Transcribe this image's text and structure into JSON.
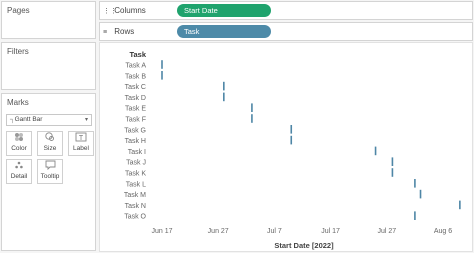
{
  "left_panel": {
    "pages_label": "Pages",
    "filters_label": "Filters",
    "marks_label": "Marks",
    "mark_type": "Gantt Bar",
    "mark_buttons": [
      {
        "label": "Color",
        "icon": "color-icon"
      },
      {
        "label": "Size",
        "icon": "size-icon"
      },
      {
        "label": "Label",
        "icon": "label-icon"
      },
      {
        "label": "Detail",
        "icon": "detail-icon"
      },
      {
        "label": "Tooltip",
        "icon": "tooltip-icon"
      }
    ]
  },
  "shelves": {
    "columns_label": "Columns",
    "columns_pill": "Start Date",
    "rows_label": "Rows",
    "rows_pill": "Task"
  },
  "colors": {
    "columns_pill": "#1fa36d",
    "rows_pill": "#4d8aa8",
    "gantt_mark": "#4e86a6"
  },
  "chart_data": {
    "type": "gantt",
    "row_header": "Task",
    "xlabel": "Start Date [2022]",
    "x_ticks": [
      "Jun 17",
      "Jun 27",
      "Jul 7",
      "Jul 17",
      "Jul 27",
      "Aug 6"
    ],
    "xlim": [
      "2022-06-13",
      "2022-08-09"
    ],
    "categories": [
      "Task A",
      "Task B",
      "Task C",
      "Task D",
      "Task E",
      "Task F",
      "Task G",
      "Task H",
      "Task I",
      "Task J",
      "Task K",
      "Task L",
      "Task M",
      "Task N",
      "Task O"
    ],
    "start_dates": [
      "2022-06-17",
      "2022-06-17",
      "2022-06-28",
      "2022-06-28",
      "2022-07-03",
      "2022-07-03",
      "2022-07-10",
      "2022-07-10",
      "2022-07-25",
      "2022-07-28",
      "2022-07-28",
      "2022-08-01",
      "2022-08-02",
      "2022-08-09",
      "2022-08-01"
    ]
  }
}
